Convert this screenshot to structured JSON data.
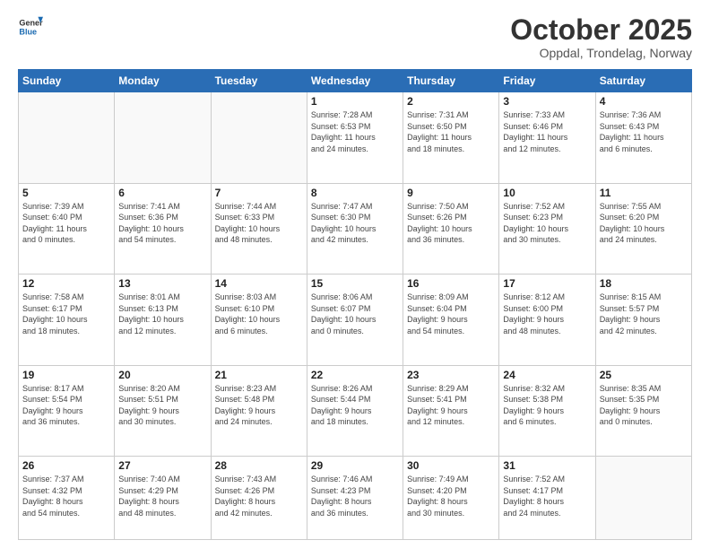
{
  "header": {
    "logo_line1": "General",
    "logo_line2": "Blue",
    "month": "October 2025",
    "location": "Oppdal, Trondelag, Norway"
  },
  "days_of_week": [
    "Sunday",
    "Monday",
    "Tuesday",
    "Wednesday",
    "Thursday",
    "Friday",
    "Saturday"
  ],
  "weeks": [
    [
      {
        "day": "",
        "info": ""
      },
      {
        "day": "",
        "info": ""
      },
      {
        "day": "",
        "info": ""
      },
      {
        "day": "1",
        "info": "Sunrise: 7:28 AM\nSunset: 6:53 PM\nDaylight: 11 hours\nand 24 minutes."
      },
      {
        "day": "2",
        "info": "Sunrise: 7:31 AM\nSunset: 6:50 PM\nDaylight: 11 hours\nand 18 minutes."
      },
      {
        "day": "3",
        "info": "Sunrise: 7:33 AM\nSunset: 6:46 PM\nDaylight: 11 hours\nand 12 minutes."
      },
      {
        "day": "4",
        "info": "Sunrise: 7:36 AM\nSunset: 6:43 PM\nDaylight: 11 hours\nand 6 minutes."
      }
    ],
    [
      {
        "day": "5",
        "info": "Sunrise: 7:39 AM\nSunset: 6:40 PM\nDaylight: 11 hours\nand 0 minutes."
      },
      {
        "day": "6",
        "info": "Sunrise: 7:41 AM\nSunset: 6:36 PM\nDaylight: 10 hours\nand 54 minutes."
      },
      {
        "day": "7",
        "info": "Sunrise: 7:44 AM\nSunset: 6:33 PM\nDaylight: 10 hours\nand 48 minutes."
      },
      {
        "day": "8",
        "info": "Sunrise: 7:47 AM\nSunset: 6:30 PM\nDaylight: 10 hours\nand 42 minutes."
      },
      {
        "day": "9",
        "info": "Sunrise: 7:50 AM\nSunset: 6:26 PM\nDaylight: 10 hours\nand 36 minutes."
      },
      {
        "day": "10",
        "info": "Sunrise: 7:52 AM\nSunset: 6:23 PM\nDaylight: 10 hours\nand 30 minutes."
      },
      {
        "day": "11",
        "info": "Sunrise: 7:55 AM\nSunset: 6:20 PM\nDaylight: 10 hours\nand 24 minutes."
      }
    ],
    [
      {
        "day": "12",
        "info": "Sunrise: 7:58 AM\nSunset: 6:17 PM\nDaylight: 10 hours\nand 18 minutes."
      },
      {
        "day": "13",
        "info": "Sunrise: 8:01 AM\nSunset: 6:13 PM\nDaylight: 10 hours\nand 12 minutes."
      },
      {
        "day": "14",
        "info": "Sunrise: 8:03 AM\nSunset: 6:10 PM\nDaylight: 10 hours\nand 6 minutes."
      },
      {
        "day": "15",
        "info": "Sunrise: 8:06 AM\nSunset: 6:07 PM\nDaylight: 10 hours\nand 0 minutes."
      },
      {
        "day": "16",
        "info": "Sunrise: 8:09 AM\nSunset: 6:04 PM\nDaylight: 9 hours\nand 54 minutes."
      },
      {
        "day": "17",
        "info": "Sunrise: 8:12 AM\nSunset: 6:00 PM\nDaylight: 9 hours\nand 48 minutes."
      },
      {
        "day": "18",
        "info": "Sunrise: 8:15 AM\nSunset: 5:57 PM\nDaylight: 9 hours\nand 42 minutes."
      }
    ],
    [
      {
        "day": "19",
        "info": "Sunrise: 8:17 AM\nSunset: 5:54 PM\nDaylight: 9 hours\nand 36 minutes."
      },
      {
        "day": "20",
        "info": "Sunrise: 8:20 AM\nSunset: 5:51 PM\nDaylight: 9 hours\nand 30 minutes."
      },
      {
        "day": "21",
        "info": "Sunrise: 8:23 AM\nSunset: 5:48 PM\nDaylight: 9 hours\nand 24 minutes."
      },
      {
        "day": "22",
        "info": "Sunrise: 8:26 AM\nSunset: 5:44 PM\nDaylight: 9 hours\nand 18 minutes."
      },
      {
        "day": "23",
        "info": "Sunrise: 8:29 AM\nSunset: 5:41 PM\nDaylight: 9 hours\nand 12 minutes."
      },
      {
        "day": "24",
        "info": "Sunrise: 8:32 AM\nSunset: 5:38 PM\nDaylight: 9 hours\nand 6 minutes."
      },
      {
        "day": "25",
        "info": "Sunrise: 8:35 AM\nSunset: 5:35 PM\nDaylight: 9 hours\nand 0 minutes."
      }
    ],
    [
      {
        "day": "26",
        "info": "Sunrise: 7:37 AM\nSunset: 4:32 PM\nDaylight: 8 hours\nand 54 minutes."
      },
      {
        "day": "27",
        "info": "Sunrise: 7:40 AM\nSunset: 4:29 PM\nDaylight: 8 hours\nand 48 minutes."
      },
      {
        "day": "28",
        "info": "Sunrise: 7:43 AM\nSunset: 4:26 PM\nDaylight: 8 hours\nand 42 minutes."
      },
      {
        "day": "29",
        "info": "Sunrise: 7:46 AM\nSunset: 4:23 PM\nDaylight: 8 hours\nand 36 minutes."
      },
      {
        "day": "30",
        "info": "Sunrise: 7:49 AM\nSunset: 4:20 PM\nDaylight: 8 hours\nand 30 minutes."
      },
      {
        "day": "31",
        "info": "Sunrise: 7:52 AM\nSunset: 4:17 PM\nDaylight: 8 hours\nand 24 minutes."
      },
      {
        "day": "",
        "info": ""
      }
    ]
  ]
}
